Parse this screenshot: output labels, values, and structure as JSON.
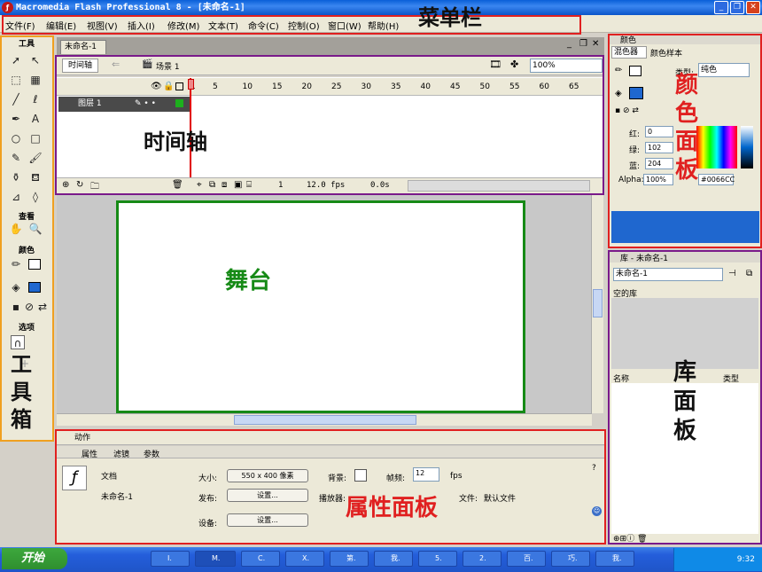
{
  "window": {
    "title": "Macromedia Flash Professional 8 - [未命名-1]",
    "app_icon": "flash-logo-icon",
    "buttons": [
      "minimize-icon",
      "restore-icon",
      "close-icon"
    ]
  },
  "menubar": {
    "items": [
      "文件(F)",
      "编辑(E)",
      "视图(V)",
      "插入(I)",
      "修改(M)",
      "文本(T)",
      "命令(C)",
      "控制(O)",
      "窗口(W)",
      "帮助(H)"
    ]
  },
  "annotations": {
    "menubar": "菜单栏",
    "timeline": "时间轴",
    "stage": "舞台",
    "toolbox": "工具箱",
    "color_panel": "颜色面板",
    "library_panel": "库面板",
    "properties_panel": "属性面板",
    "colors": {
      "red": "#e02020",
      "purple": "#7a1a8a",
      "green": "#168a16",
      "orange": "#f0a020",
      "black": "#111111"
    }
  },
  "toolbox": {
    "title": "工具",
    "view_label": "查看",
    "color_label": "颜色",
    "options_label": "选项"
  },
  "document": {
    "tab": "未命名-1",
    "timeline_button": "时间轴",
    "scene": "场景 1",
    "zoom": "100%",
    "layer_name": "图层 1",
    "frame_numbers": [
      "1",
      "5",
      "10",
      "15",
      "20",
      "25",
      "30",
      "35",
      "40",
      "45",
      "50",
      "55",
      "60",
      "65"
    ],
    "current_frame": "1",
    "fps": "12.0 fps",
    "elapsed": "0.0s"
  },
  "properties": {
    "actions_label": "动作",
    "tabs": [
      "属性",
      "滤镜",
      "参数"
    ],
    "doc_type": "文档",
    "doc_name": "未命名-1",
    "size_label": "大小:",
    "size_value": "550 x 400 像素",
    "background_label": "背景:",
    "framerate_label": "帧频:",
    "framerate_value": "12",
    "fps_unit": "fps",
    "publish_label": "发布:",
    "settings_button": "设置...",
    "player_label": "播放器:",
    "profile_label": "文件:",
    "profile_value": "默认文件",
    "device_label": "设备:",
    "device_button": "设置..."
  },
  "color_panel": {
    "title": "颜色",
    "tabs": [
      "混色器",
      "颜色样本"
    ],
    "type_label": "类型:",
    "type_value": "纯色",
    "red_label": "红:",
    "red_value": "0",
    "green_label": "绿:",
    "green_value": "102",
    "blue_label": "蓝:",
    "blue_value": "204",
    "alpha_label": "Alpha:",
    "alpha_value": "100%",
    "hex_value": "#0066CC",
    "fill_color": "#0066cc"
  },
  "library_panel": {
    "title": "库 - 未命名-1",
    "doc_select": "未命名-1",
    "empty_text": "空的库",
    "col_name": "名称",
    "col_type": "类型"
  },
  "taskbar": {
    "start": "开始",
    "items": [
      "I.",
      "M.",
      "C.",
      "X.",
      "第.",
      "我.",
      "5.",
      "2.",
      "百.",
      "巧.",
      "我."
    ],
    "time": "9:32"
  }
}
